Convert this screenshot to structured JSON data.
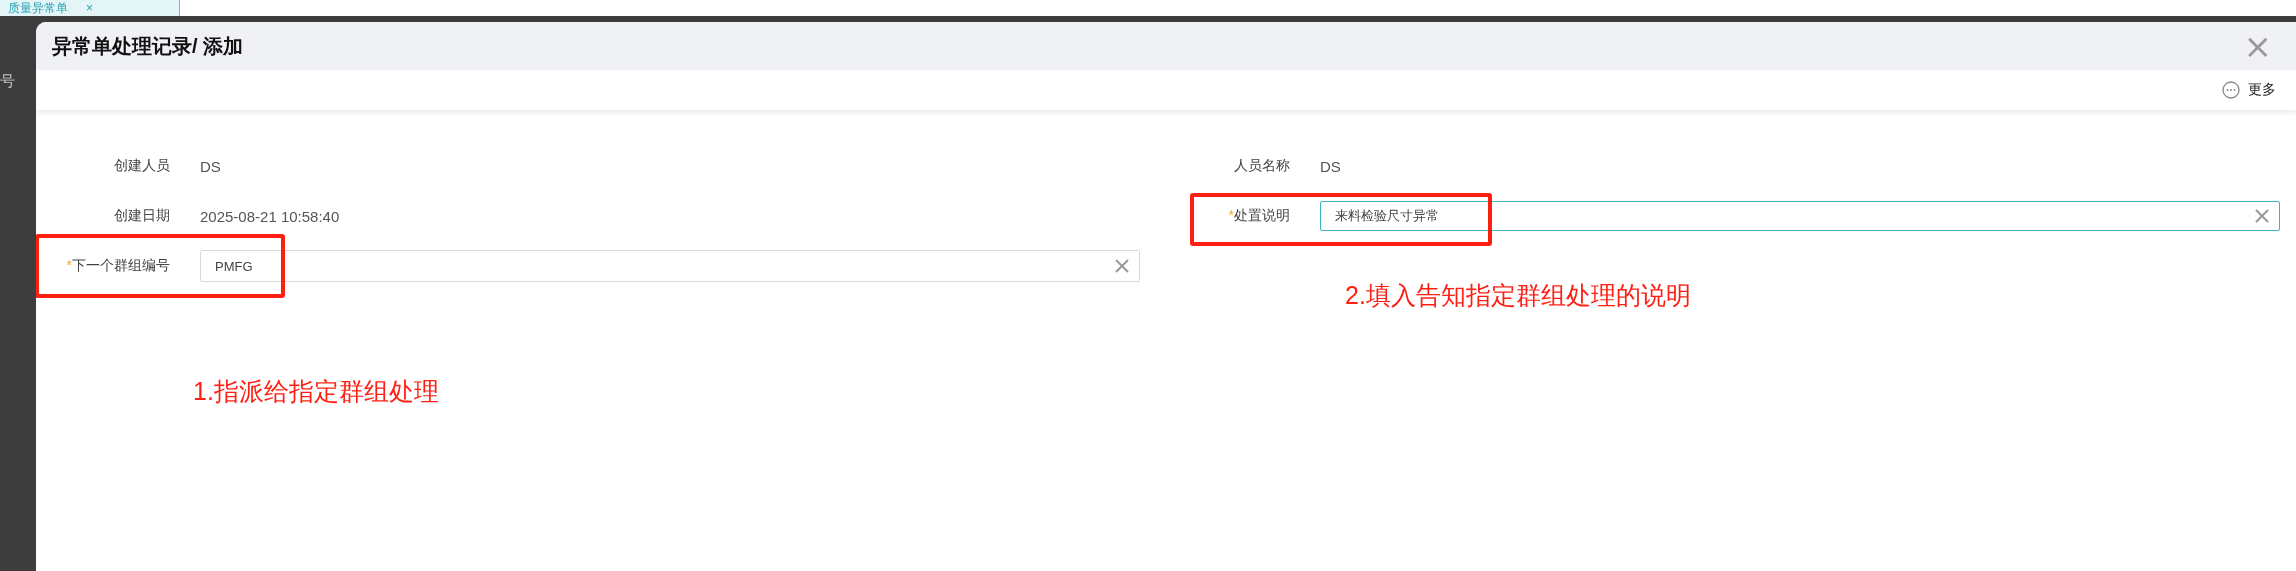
{
  "background": {
    "tab": {
      "label": "质量异常单",
      "close": "×"
    },
    "side_text": "号"
  },
  "dialog": {
    "title": "异常单处理记录/ 添加",
    "close": "×",
    "toolbar": {
      "more": "更多"
    },
    "columns": [
      {
        "fields": [
          {
            "kind": "text",
            "label": "创建人员",
            "value": "DS",
            "highlighted": false
          },
          {
            "kind": "text",
            "label": "创建日期",
            "value": "2025-08-21 10:58:40",
            "highlighted": false
          },
          {
            "kind": "input",
            "label": "下一个群组编号",
            "required_mark": "*",
            "value": "PMFG",
            "focused": false,
            "highlighted": true
          }
        ]
      },
      {
        "fields": [
          {
            "kind": "text",
            "label": "人员名称",
            "value": "DS",
            "highlighted": false
          },
          {
            "kind": "input",
            "label": "处置说明",
            "required_mark": "*",
            "value": "来料检验尺寸异常",
            "focused": true,
            "highlighted": true
          }
        ]
      }
    ]
  },
  "annotations": [
    {
      "text": "1.指派给指定群组处理"
    },
    {
      "text": "2.填入告知指定群组处理的说明"
    }
  ]
}
